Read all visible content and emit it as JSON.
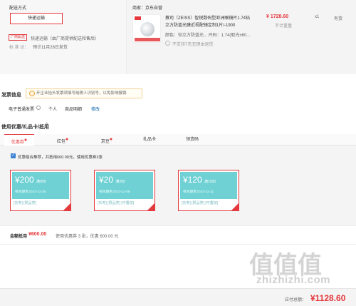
{
  "shipping": {
    "label": "配送方式",
    "option": "快递运输",
    "tag": "厂商配送",
    "line1": "快递运输（由厂商提供配送和售后）",
    "time_label": "标 准 达：",
    "time_value": "预计11月26日发货"
  },
  "seller": {
    "label": "商家：",
    "name": "京东自营"
  },
  "product": {
    "title_line1": "蔡司（ZEISS）智锐数码型亚洲眼镜片1.74钻",
    "title_line2": "立方防蓝光膜近视配镜定制1片/-1900",
    "spec": "颜色：钻立方防蓝光... 尺码：1.74(取光±60...",
    "return_note": "不支持7天无理由退货",
    "price": "¥ 1728.60",
    "stock": "不计重量",
    "qty": "x1",
    "status": "有货"
  },
  "invoice": {
    "heading": "发票信息",
    "notice": "开企业抬头发票须填写纳税人识别号，以免影响报销",
    "type": "电子普通发票",
    "title": "个人",
    "content": "商品明细",
    "edit": "修改"
  },
  "coupons": {
    "heading": "使用优惠/礼品卡/抵用",
    "tabs": [
      {
        "label": "优惠券",
        "dot": "●"
      },
      {
        "label": "红包",
        "dot": "●"
      },
      {
        "label": "京豆",
        "dot": "●"
      },
      {
        "label": "礼品卡",
        "dot": ""
      },
      {
        "label": "领货码",
        "dot": ""
      }
    ],
    "combo_check": "✓",
    "combo_text": "优惠组合推荐，共抵用600.00元，使用优惠券3张",
    "items": [
      {
        "amount": "¥200",
        "cond": "满999",
        "date": "有效期至2023-11-30",
        "tags": "[东券] [限品类]"
      },
      {
        "amount": "¥20",
        "cond": "满200",
        "date": "有效期至2023-11-08",
        "tags": "[东券] [限品类] [可叠加]"
      },
      {
        "amount": "¥120",
        "cond": "满1500",
        "date": "有效期至2023-11-11",
        "tags": "[东券] [限品类] [可叠加]"
      }
    ]
  },
  "summary": {
    "label": "金额抵用",
    "amount": "¥600.00",
    "detail": "使用优惠券 3 张，优惠 600.00 元"
  },
  "payment": {
    "label": "应付总额：",
    "total": "¥1128.60"
  },
  "watermark": {
    "chars": [
      "值",
      "值",
      "值"
    ],
    "url": "zhizhizhi.com"
  },
  "colors": {
    "accent": "#e4393c",
    "coupon_teal": "#6fd1d4",
    "link": "#005ea7"
  }
}
